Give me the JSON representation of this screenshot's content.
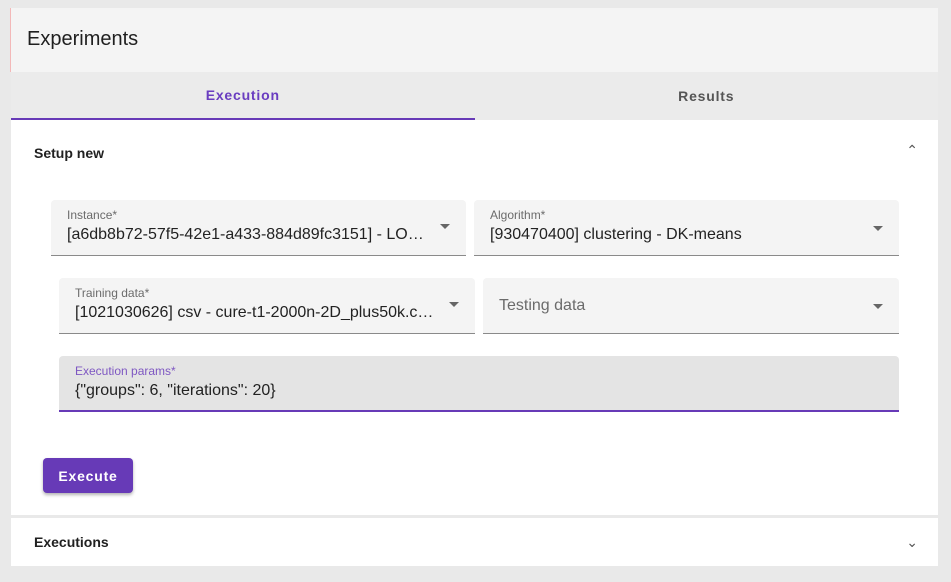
{
  "header": {
    "title": "Experiments"
  },
  "tabs": [
    {
      "label": "Execution",
      "active": true
    },
    {
      "label": "Results",
      "active": false
    }
  ],
  "setup": {
    "title": "Setup new",
    "instance": {
      "label": "Instance*",
      "value": "[a6db8b72-57f5-42e1-a433-884d89fc3151] - LO…"
    },
    "algorithm": {
      "label": "Algorithm*",
      "value": "[930470400] clustering - DK-means"
    },
    "training": {
      "label": "Training data*",
      "value": "[1021030626] csv - cure-t1-2000n-2D_plus50k.c…"
    },
    "testing": {
      "placeholder": "Testing data"
    },
    "params": {
      "label": "Execution params*",
      "value": "{\"groups\": 6, \"iterations\": 20}"
    },
    "execute_label": "Execute"
  },
  "executions": {
    "title": "Executions"
  },
  "colors": {
    "accent": "#673ab7"
  }
}
